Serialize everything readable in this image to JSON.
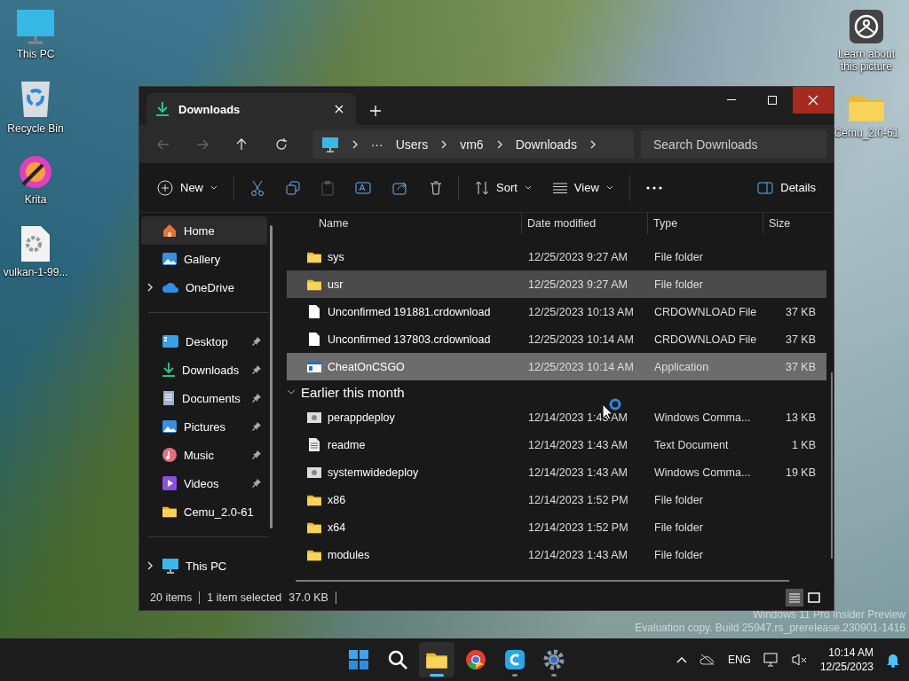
{
  "desktop": {
    "left_icons": [
      {
        "label": "This PC",
        "kind": "monitor"
      },
      {
        "label": "Recycle Bin",
        "kind": "bin"
      },
      {
        "label": "Krita",
        "kind": "krita"
      },
      {
        "label": "vulkan-1-99...",
        "kind": "gear-file"
      }
    ],
    "right_icons": [
      {
        "label": "Learn about this picture",
        "kind": "learn"
      },
      {
        "label": "Cemu_2.0-61",
        "kind": "folder"
      }
    ]
  },
  "window": {
    "tab": {
      "title": "Downloads"
    },
    "breadcrumb_overflow": "···",
    "breadcrumb": [
      "Users",
      "vm6",
      "Downloads"
    ],
    "search": {
      "placeholder": "Search Downloads"
    },
    "toolbar": {
      "new": "New",
      "sort": "Sort",
      "view": "View",
      "details": "Details"
    },
    "sidebar": [
      [
        {
          "label": "Home",
          "kind": "home",
          "selected": true,
          "pinned": false,
          "expandable": false
        },
        {
          "label": "Gallery",
          "kind": "gallery",
          "selected": false,
          "pinned": false,
          "expandable": false
        },
        {
          "label": "OneDrive",
          "kind": "cloud",
          "selected": false,
          "pinned": false,
          "expandable": true
        }
      ],
      [
        {
          "label": "Desktop",
          "kind": "desktop",
          "selected": false,
          "pinned": true,
          "expandable": false
        },
        {
          "label": "Downloads",
          "kind": "download",
          "selected": false,
          "pinned": true,
          "expandable": false
        },
        {
          "label": "Documents",
          "kind": "document",
          "selected": false,
          "pinned": true,
          "expandable": false
        },
        {
          "label": "Pictures",
          "kind": "gallery",
          "selected": false,
          "pinned": true,
          "expandable": false
        },
        {
          "label": "Music",
          "kind": "music",
          "selected": false,
          "pinned": true,
          "expandable": false
        },
        {
          "label": "Videos",
          "kind": "video",
          "selected": false,
          "pinned": true,
          "expandable": false
        },
        {
          "label": "Cemu_2.0-61",
          "kind": "folder",
          "selected": false,
          "pinned": false,
          "expandable": false
        }
      ],
      [
        {
          "label": "This PC",
          "kind": "monitor",
          "selected": false,
          "pinned": false,
          "expandable": true
        }
      ]
    ],
    "columns": [
      "Name",
      "Date modified",
      "Type",
      "Size"
    ],
    "groups": [
      {
        "rows": [
          {
            "name": "sys",
            "date": "12/25/2023 9:27 AM",
            "type": "File folder",
            "kind": "folder",
            "selected": false,
            "hovered": false
          },
          {
            "name": "usr",
            "date": "12/25/2023 9:27 AM",
            "type": "File folder",
            "kind": "folder",
            "selected": false,
            "hovered": true
          },
          {
            "name": "Unconfirmed 191881.crdownload",
            "date": "12/25/2023 10:13 AM",
            "type": "CRDOWNLOAD File",
            "size": "37 KB",
            "kind": "file",
            "selected": false,
            "hovered": false
          },
          {
            "name": "Unconfirmed 137803.crdownload",
            "date": "12/25/2023 10:14 AM",
            "type": "CRDOWNLOAD File",
            "size": "37 KB",
            "kind": "file",
            "selected": false,
            "hovered": false
          },
          {
            "name": "CheatOnCSGO",
            "date": "12/25/2023 10:14 AM",
            "type": "Application",
            "size": "37 KB",
            "kind": "app",
            "selected": true,
            "hovered": false
          }
        ]
      },
      {
        "title": "Earlier this month",
        "expanded": true,
        "rows": [
          {
            "name": "perappdeploy",
            "date": "12/14/2023 1:43 AM",
            "type": "Windows Comma...",
            "size": "13 KB",
            "kind": "script",
            "selected": false,
            "hovered": false
          },
          {
            "name": "readme",
            "date": "12/14/2023 1:43 AM",
            "type": "Text Document",
            "size": "1 KB",
            "kind": "text",
            "selected": false,
            "hovered": false
          },
          {
            "name": "systemwidedeploy",
            "date": "12/14/2023 1:43 AM",
            "type": "Windows Comma...",
            "size": "19 KB",
            "kind": "script",
            "selected": false,
            "hovered": false
          },
          {
            "name": "x86",
            "date": "12/14/2023 1:52 PM",
            "type": "File folder",
            "kind": "folder",
            "selected": false,
            "hovered": false
          },
          {
            "name": "x64",
            "date": "12/14/2023 1:52 PM",
            "type": "File folder",
            "kind": "folder",
            "selected": false,
            "hovered": false
          },
          {
            "name": "modules",
            "date": "12/14/2023 1:43 AM",
            "type": "File folder",
            "kind": "folder",
            "selected": false,
            "hovered": false
          }
        ]
      }
    ],
    "status": {
      "count": "20 items",
      "selection": "1 item selected",
      "selection_size": "37.0 KB"
    },
    "views": [
      {
        "kind": "details",
        "selected": true
      },
      {
        "kind": "tiles",
        "selected": false
      }
    ]
  },
  "watermark": [
    "Windows 11 Pro Insider Preview",
    "Evaluation copy. Build 25947.rs_prerelease.230901-1416"
  ],
  "taskbar": {
    "apps": [
      {
        "kind": "start",
        "selected": false,
        "running": false
      },
      {
        "kind": "search",
        "selected": false,
        "running": false
      },
      {
        "kind": "explorer",
        "selected": true,
        "running": true
      },
      {
        "kind": "chrome",
        "selected": false,
        "running": false
      },
      {
        "kind": "c-app",
        "selected": false,
        "running": true
      },
      {
        "kind": "settings",
        "selected": false,
        "running": true
      }
    ],
    "language": "ENG",
    "time": "10:14 AM",
    "date": "12/25/2023"
  }
}
